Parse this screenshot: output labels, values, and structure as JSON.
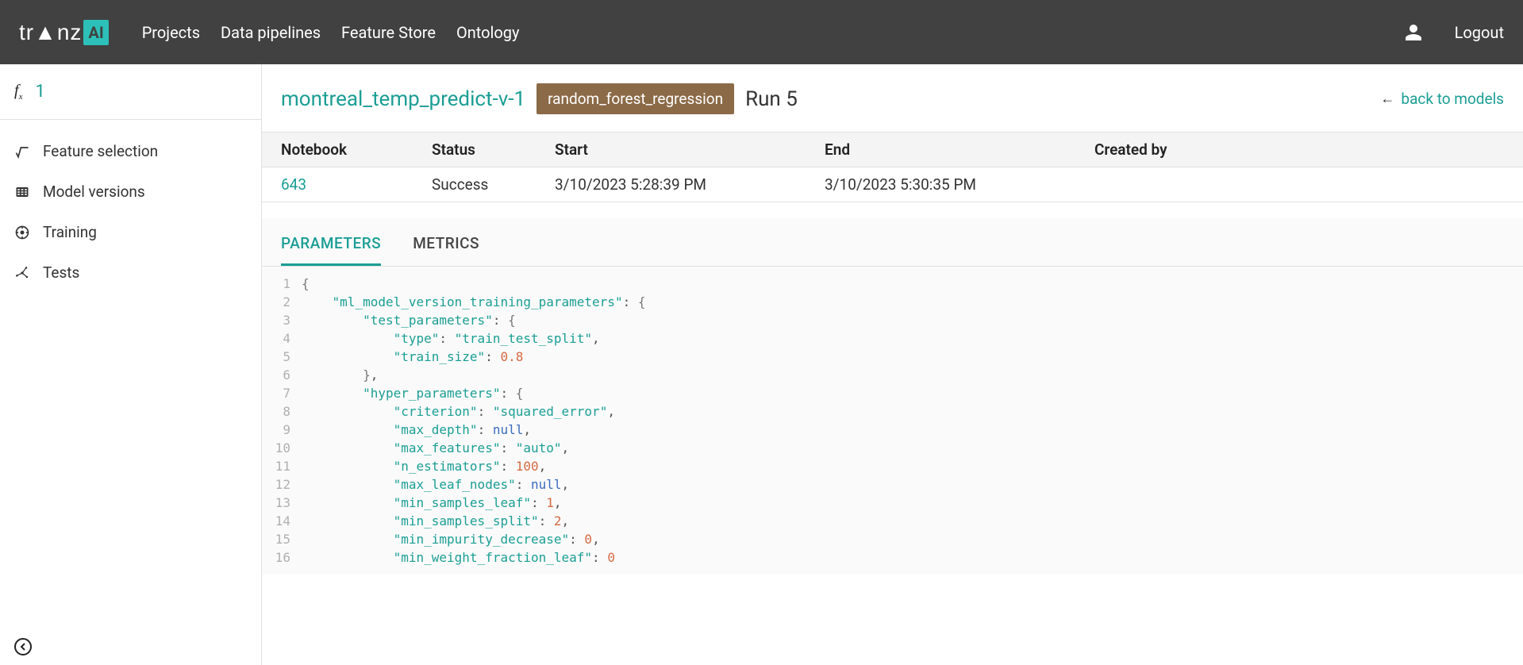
{
  "topnav": {
    "items": [
      "Projects",
      "Data pipelines",
      "Feature Store",
      "Ontology"
    ],
    "logout": "Logout"
  },
  "sidebar": {
    "fx_number": "1",
    "items": [
      {
        "label": "Feature selection"
      },
      {
        "label": "Model versions"
      },
      {
        "label": "Training"
      },
      {
        "label": "Tests"
      }
    ]
  },
  "header": {
    "model_name": "montreal_temp_predict-v-1",
    "model_type": "random_forest_regression",
    "run_title": "Run 5",
    "back_label": "back to models"
  },
  "run_table": {
    "headers": [
      "Notebook",
      "Status",
      "Start",
      "End",
      "Created by"
    ],
    "row": {
      "notebook": "643",
      "status": "Success",
      "start": "3/10/2023 5:28:39 PM",
      "end": "3/10/2023 5:30:35 PM",
      "created_by": ""
    }
  },
  "tabs": {
    "parameters": "PARAMETERS",
    "metrics": "METRICS"
  },
  "code": {
    "lines": [
      [
        {
          "t": "brace",
          "v": "{"
        }
      ],
      [
        {
          "t": "indent",
          "v": "    "
        },
        {
          "t": "key",
          "v": "\"ml_model_version_training_parameters\""
        },
        {
          "t": "punct",
          "v": ": "
        },
        {
          "t": "brace",
          "v": "{"
        }
      ],
      [
        {
          "t": "indent",
          "v": "        "
        },
        {
          "t": "key",
          "v": "\"test_parameters\""
        },
        {
          "t": "punct",
          "v": ": "
        },
        {
          "t": "brace",
          "v": "{"
        }
      ],
      [
        {
          "t": "indent",
          "v": "            "
        },
        {
          "t": "key",
          "v": "\"type\""
        },
        {
          "t": "punct",
          "v": ": "
        },
        {
          "t": "str",
          "v": "\"train_test_split\""
        },
        {
          "t": "punct",
          "v": ","
        }
      ],
      [
        {
          "t": "indent",
          "v": "            "
        },
        {
          "t": "key",
          "v": "\"train_size\""
        },
        {
          "t": "punct",
          "v": ": "
        },
        {
          "t": "num",
          "v": "0.8"
        }
      ],
      [
        {
          "t": "indent",
          "v": "        "
        },
        {
          "t": "brace",
          "v": "}"
        },
        {
          "t": "punct",
          "v": ","
        }
      ],
      [
        {
          "t": "indent",
          "v": "        "
        },
        {
          "t": "key",
          "v": "\"hyper_parameters\""
        },
        {
          "t": "punct",
          "v": ": "
        },
        {
          "t": "brace",
          "v": "{"
        }
      ],
      [
        {
          "t": "indent",
          "v": "            "
        },
        {
          "t": "key",
          "v": "\"criterion\""
        },
        {
          "t": "punct",
          "v": ": "
        },
        {
          "t": "str",
          "v": "\"squared_error\""
        },
        {
          "t": "punct",
          "v": ","
        }
      ],
      [
        {
          "t": "indent",
          "v": "            "
        },
        {
          "t": "key",
          "v": "\"max_depth\""
        },
        {
          "t": "punct",
          "v": ": "
        },
        {
          "t": "null",
          "v": "null"
        },
        {
          "t": "punct",
          "v": ","
        }
      ],
      [
        {
          "t": "indent",
          "v": "            "
        },
        {
          "t": "key",
          "v": "\"max_features\""
        },
        {
          "t": "punct",
          "v": ": "
        },
        {
          "t": "str",
          "v": "\"auto\""
        },
        {
          "t": "punct",
          "v": ","
        }
      ],
      [
        {
          "t": "indent",
          "v": "            "
        },
        {
          "t": "key",
          "v": "\"n_estimators\""
        },
        {
          "t": "punct",
          "v": ": "
        },
        {
          "t": "num",
          "v": "100"
        },
        {
          "t": "punct",
          "v": ","
        }
      ],
      [
        {
          "t": "indent",
          "v": "            "
        },
        {
          "t": "key",
          "v": "\"max_leaf_nodes\""
        },
        {
          "t": "punct",
          "v": ": "
        },
        {
          "t": "null",
          "v": "null"
        },
        {
          "t": "punct",
          "v": ","
        }
      ],
      [
        {
          "t": "indent",
          "v": "            "
        },
        {
          "t": "key",
          "v": "\"min_samples_leaf\""
        },
        {
          "t": "punct",
          "v": ": "
        },
        {
          "t": "num",
          "v": "1"
        },
        {
          "t": "punct",
          "v": ","
        }
      ],
      [
        {
          "t": "indent",
          "v": "            "
        },
        {
          "t": "key",
          "v": "\"min_samples_split\""
        },
        {
          "t": "punct",
          "v": ": "
        },
        {
          "t": "num",
          "v": "2"
        },
        {
          "t": "punct",
          "v": ","
        }
      ],
      [
        {
          "t": "indent",
          "v": "            "
        },
        {
          "t": "key",
          "v": "\"min_impurity_decrease\""
        },
        {
          "t": "punct",
          "v": ": "
        },
        {
          "t": "num",
          "v": "0"
        },
        {
          "t": "punct",
          "v": ","
        }
      ],
      [
        {
          "t": "indent",
          "v": "            "
        },
        {
          "t": "key",
          "v": "\"min_weight_fraction_leaf\""
        },
        {
          "t": "punct",
          "v": ": "
        },
        {
          "t": "num",
          "v": "0"
        }
      ]
    ]
  }
}
